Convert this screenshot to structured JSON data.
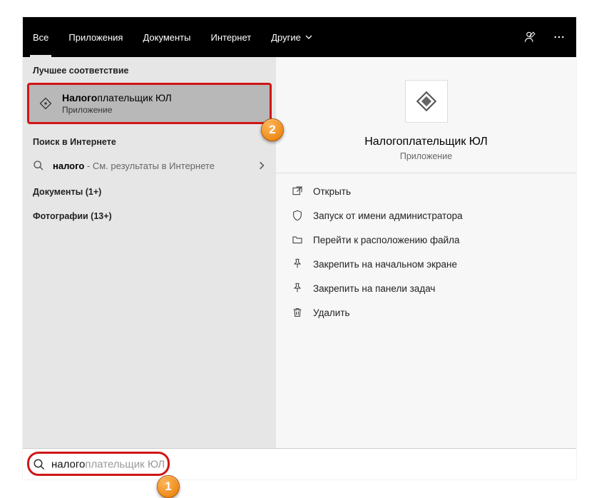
{
  "header": {
    "tabs": {
      "all": "Все",
      "apps": "Приложения",
      "docs": "Документы",
      "web": "Интернет",
      "more": "Другие"
    }
  },
  "left": {
    "best_match_label": "Лучшее соответствие",
    "best_match": {
      "title_bold": "Налого",
      "title_rest": "плательщик ЮЛ",
      "subtitle": "Приложение"
    },
    "web_label": "Поиск в Интернете",
    "web_row": {
      "bold": "налого",
      "rest": " - См. результаты в Интернете"
    },
    "docs_label": "Документы (1+)",
    "photos_label": "Фотографии (13+)"
  },
  "preview": {
    "title": "Налогоплательщик ЮЛ",
    "subtitle": "Приложение"
  },
  "actions": {
    "open": "Открыть",
    "admin": "Запуск от имени администратора",
    "location": "Перейти к расположению файла",
    "pin_start": "Закрепить на начальном экране",
    "pin_task": "Закрепить на панели задач",
    "delete": "Удалить"
  },
  "search": {
    "typed": "налого",
    "hint": "плательщик ЮЛ",
    "value": "налогоплательщик ЮЛ"
  },
  "callouts": {
    "one": "1",
    "two": "2"
  }
}
